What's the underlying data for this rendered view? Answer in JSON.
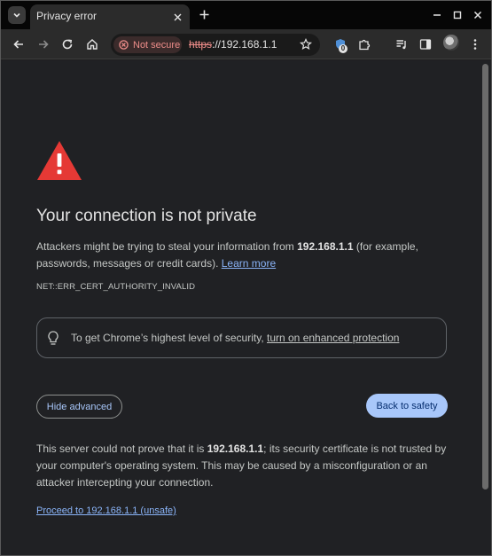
{
  "tab": {
    "title": "Privacy error"
  },
  "omnibox": {
    "security_chip": "Not secure",
    "url_scheme": "https",
    "url_rest": "://192.168.1.1"
  },
  "extensions": {
    "badge_count": "0"
  },
  "page": {
    "heading": "Your connection is not private",
    "para1_before": "Attackers might be trying to steal your information from ",
    "para1_host": "192.168.1.1",
    "para1_after": " (for example, passwords, messages or credit cards). ",
    "learn_more": "Learn more",
    "error_code": "NET::ERR_CERT_AUTHORITY_INVALID",
    "promo_text": "To get Chrome’s highest level of security, ",
    "promo_link": "turn on enhanced protection",
    "hide_advanced": "Hide advanced",
    "back_to_safety": "Back to safety",
    "details_before": "This server could not prove that it is ",
    "details_host": "192.168.1.1",
    "details_after": "; its security certificate is not trusted by your computer's operating system. This may be caused by a misconfiguration or an attacker intercepting your connection.",
    "proceed_link": "Proceed to 192.168.1.1 (unsafe)"
  },
  "colors": {
    "warning_red": "#e53935",
    "link_blue": "#8ab4f8",
    "primary_button": "#a8c7fa",
    "not_secure_red": "#ee8d8a",
    "page_background": "#202124"
  },
  "icons": {
    "tab_search": "chevron-down-icon",
    "tab_close": "close-icon",
    "new_tab": "plus-icon",
    "back": "arrow-left-icon",
    "forward": "arrow-right-icon",
    "reload": "reload-icon",
    "home": "home-icon",
    "bookmark": "star-icon",
    "warning": "warning-triangle-icon",
    "bulb": "lightbulb-icon"
  }
}
